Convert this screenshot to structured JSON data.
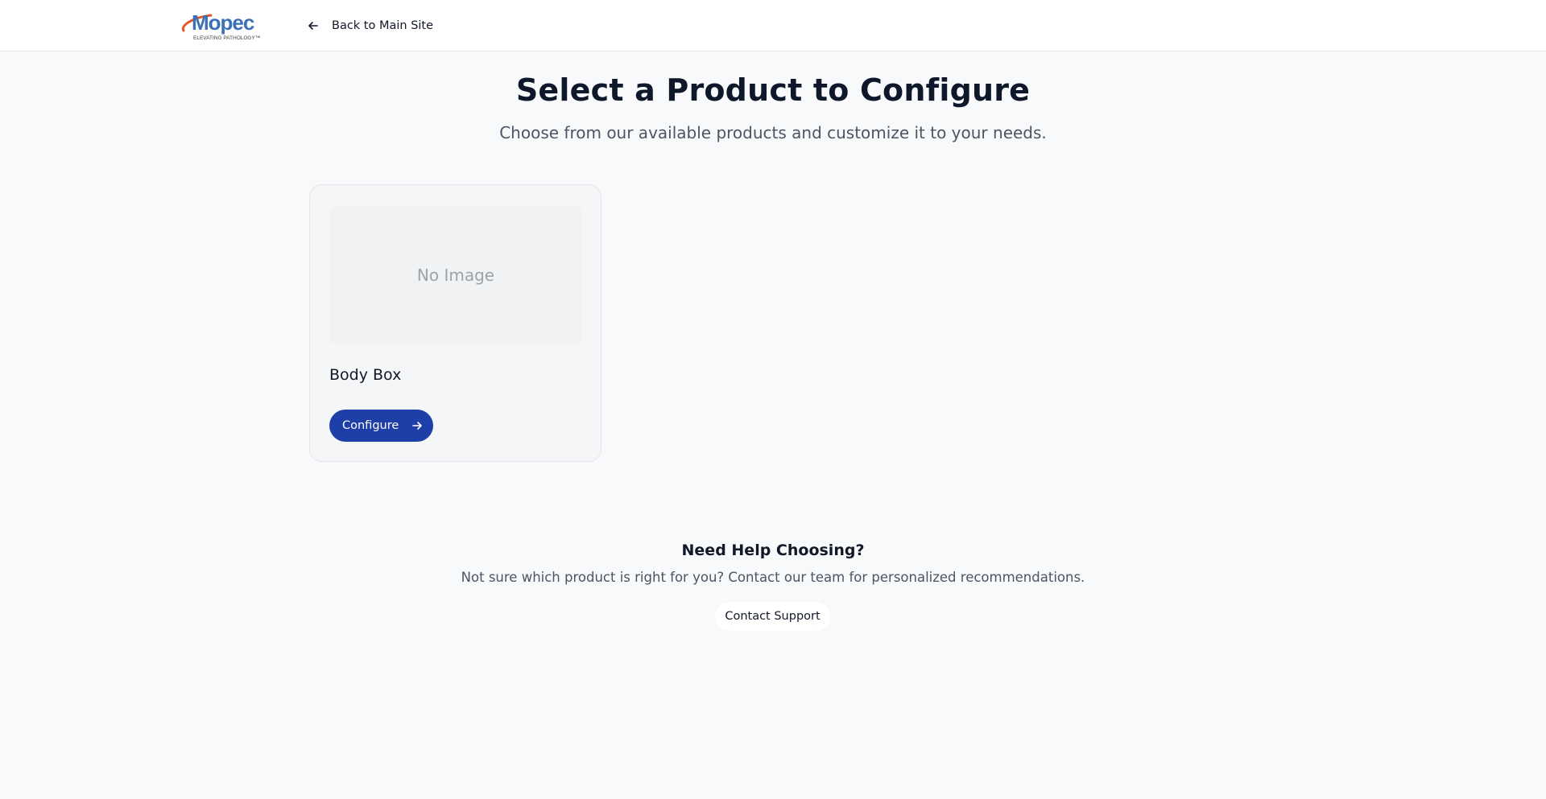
{
  "header": {
    "logo": {
      "brand": "Mopec",
      "tagline": "ELEVATING PATHOLOGY™",
      "icon": "mopec-logo"
    },
    "back_link": {
      "label": "Back to Main Site",
      "icon": "arrow-left-icon"
    }
  },
  "main": {
    "title": "Select a Product to Configure",
    "subtitle": "Choose from our available products and customize it to your needs.",
    "products": [
      {
        "image_placeholder": "No Image",
        "name": "Body Box",
        "button_label": "Configure",
        "button_icon": "arrow-right-icon"
      }
    ]
  },
  "help": {
    "title": "Need Help Choosing?",
    "text": "Not sure which product is right for you? Contact our team for personalized recommendations.",
    "button_label": "Contact Support"
  },
  "colors": {
    "accent": "#1e3ea8",
    "page_bg": "#f8f9fb",
    "logo_blue": "#3b6fb6",
    "logo_orange": "#e2572b"
  }
}
